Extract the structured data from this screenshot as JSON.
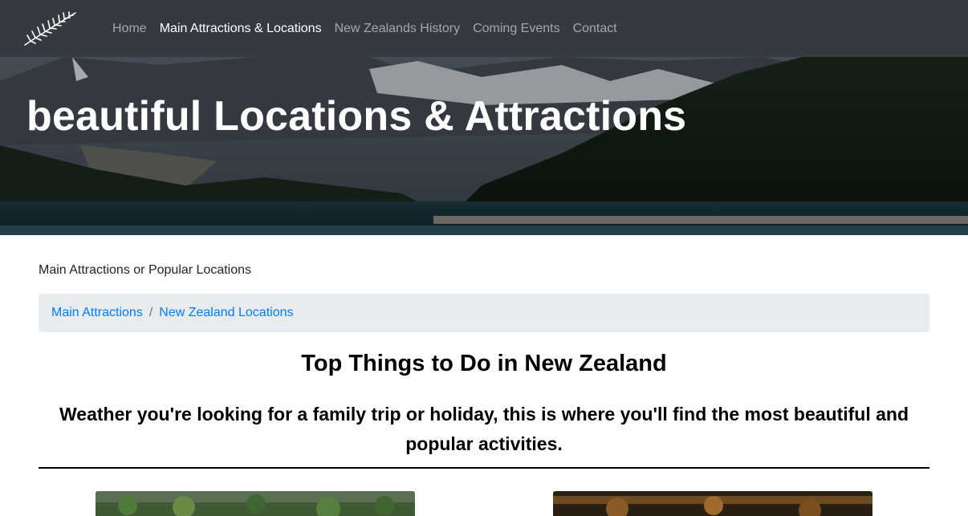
{
  "nav": {
    "logo_icon": "silver-fern-icon",
    "links": [
      {
        "label": "Home",
        "active": false
      },
      {
        "label": "Main Attractions & Locations",
        "active": true
      },
      {
        "label": "New Zealands History",
        "active": false
      },
      {
        "label": "Coming Events",
        "active": false
      },
      {
        "label": "Contact",
        "active": false
      }
    ]
  },
  "hero": {
    "title": "beautiful Locations & Attractions"
  },
  "main": {
    "lead": "Main Attractions or Popular Locations",
    "breadcrumb": [
      "Main Attractions",
      "New Zealand Locations"
    ],
    "heading": "Top Things to Do in New Zealand",
    "subheading": "Weather you're looking for a family trip or holiday, this is where you'll find the most beautiful and popular activities."
  },
  "colors": {
    "navbar": "#343a40",
    "link": "#007bff",
    "breadcrumb_bg": "#e9ecef"
  }
}
